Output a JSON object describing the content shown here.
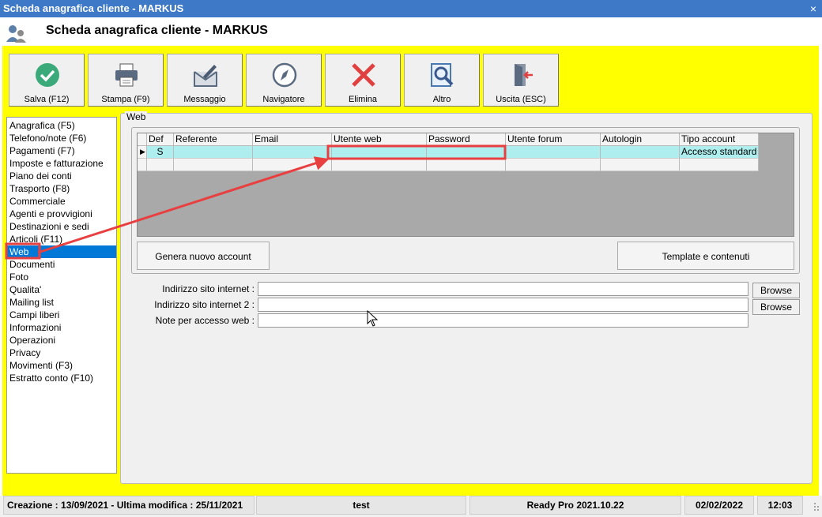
{
  "window": {
    "title": "Scheda anagrafica cliente - MARKUS",
    "close": "×"
  },
  "header": {
    "title": "Scheda anagrafica cliente - MARKUS",
    "icon": "user-card-icon"
  },
  "toolbar": {
    "save": "Salva (F12)",
    "print": "Stampa (F9)",
    "message": "Messaggio",
    "navigator": "Navigatore",
    "delete": "Elimina",
    "other": "Altro",
    "exit": "Uscita (ESC)"
  },
  "sidebar": {
    "items": [
      "Anagrafica (F5)",
      "Telefono/note (F6)",
      "Pagamenti (F7)",
      "Imposte e fatturazione",
      "Piano dei conti",
      "Trasporto (F8)",
      "Commerciale",
      "Agenti e provvigioni",
      "Destinazioni e sedi",
      "Articoli (F11)",
      "Web",
      "Documenti",
      "Foto",
      "Qualita'",
      "Mailing list",
      "Campi liberi",
      "Informazioni",
      "Operazioni",
      "Privacy",
      "Movimenti (F3)",
      "Estratto conto (F10)"
    ],
    "selected": "Web"
  },
  "web": {
    "legend": "Web",
    "grid": {
      "columns": [
        "Def",
        "Referente",
        "Email",
        "Utente web",
        "Password",
        "Utente forum",
        "Autologin",
        "Tipo account"
      ],
      "rows": [
        [
          "S",
          "",
          "",
          "",
          "",
          "",
          "",
          "Accesso standard"
        ]
      ]
    },
    "buttons": {
      "new_account": "Genera nuovo account",
      "templates": "Template e contenuti"
    },
    "fields": {
      "site_label": "Indirizzo sito internet :",
      "site_value": "",
      "site2_label": "Indirizzo sito internet 2 :",
      "site2_value": "",
      "notes_label": "Note per accesso web :",
      "notes_value": ""
    },
    "browse": "Browse"
  },
  "status": {
    "dates": "Creazione : 13/09/2021 - Ultima modifica : 25/11/2021",
    "user": "test",
    "app": "Ready Pro 2021.10.22",
    "date": "02/02/2022",
    "time": "12:03"
  },
  "colors": {
    "title_bar": "#3d79c6",
    "highlight": "#ffff00",
    "annotation": "#e84040",
    "selected_row": "#aeeeee"
  }
}
